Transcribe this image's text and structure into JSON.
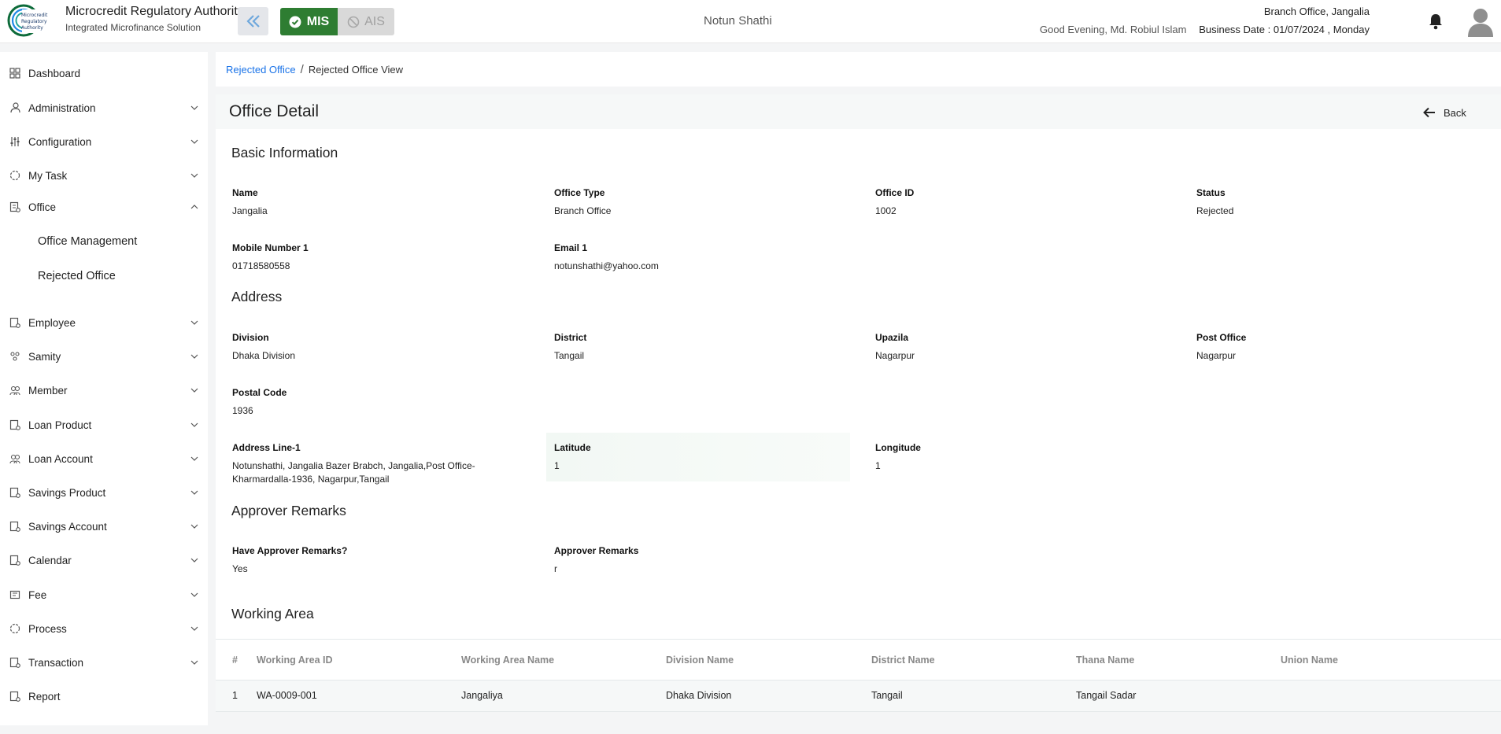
{
  "header": {
    "brand_title": "Microcredit Regulatory Authority",
    "brand_subtitle": "Integrated Microfinance Solution",
    "logo_text": "Microcredit Regulatory Authority",
    "mode_active": "MIS",
    "mode_inactive": "AIS",
    "org_name": "Notun Shathi",
    "greeting": "Good Evening, Md. Robiul Islam",
    "branch": "Branch Office, Jangalia",
    "business_date": "Business Date : 01/07/2024 , Monday",
    "accent_color": "#2e7d32"
  },
  "sidebar": {
    "items": [
      {
        "label": "Dashboard",
        "icon": "dashboard-icon",
        "chevron": false
      },
      {
        "label": "Administration",
        "icon": "admin-icon",
        "chevron": true
      },
      {
        "label": "Configuration",
        "icon": "config-icon",
        "chevron": true
      },
      {
        "label": "My Task",
        "icon": "task-icon",
        "chevron": true
      },
      {
        "label": "Office",
        "icon": "office-icon",
        "chevron": true,
        "expanded": true
      },
      {
        "label": "Employee",
        "icon": "employee-icon",
        "chevron": true
      },
      {
        "label": "Samity",
        "icon": "samity-icon",
        "chevron": true
      },
      {
        "label": "Member",
        "icon": "member-icon",
        "chevron": true
      },
      {
        "label": "Loan Product",
        "icon": "loan-product-icon",
        "chevron": true
      },
      {
        "label": "Loan Account",
        "icon": "loan-account-icon",
        "chevron": true
      },
      {
        "label": "Savings Product",
        "icon": "savings-product-icon",
        "chevron": true
      },
      {
        "label": "Savings Account",
        "icon": "savings-account-icon",
        "chevron": true
      },
      {
        "label": "Calendar",
        "icon": "calendar-icon",
        "chevron": true
      },
      {
        "label": "Fee",
        "icon": "fee-icon",
        "chevron": true
      },
      {
        "label": "Process",
        "icon": "process-icon",
        "chevron": true
      },
      {
        "label": "Transaction",
        "icon": "transaction-icon",
        "chevron": true
      },
      {
        "label": "Report",
        "icon": "report-icon",
        "chevron": false
      }
    ],
    "office_sub": [
      "Office Management",
      "Rejected Office"
    ]
  },
  "breadcrumb": {
    "parent": "Rejected Office",
    "separator": "/",
    "current": "Rejected Office View"
  },
  "page": {
    "title": "Office Detail",
    "back_label": "Back"
  },
  "basic": {
    "title": "Basic Information",
    "name_label": "Name",
    "name": "Jangalia",
    "type_label": "Office Type",
    "type": "Branch Office",
    "id_label": "Office ID",
    "id": "1002",
    "status_label": "Status",
    "status": "Rejected",
    "mobile_label": "Mobile Number 1",
    "mobile": "01718580558",
    "email_label": "Email 1",
    "email": "notunshathi@yahoo.com"
  },
  "address": {
    "title": "Address",
    "division_label": "Division",
    "division": "Dhaka Division",
    "district_label": "District",
    "district": "Tangail",
    "upazila_label": "Upazila",
    "upazila": "Nagarpur",
    "post_label": "Post Office",
    "post": "Nagarpur",
    "postal_label": "Postal Code",
    "postal": "1936",
    "line1_label": "Address Line-1",
    "line1": "Notunshathi, Jangalia Bazer Brabch, Jangalia,Post Office-Kharmardalla-1936, Nagarpur,Tangail",
    "lat_label": "Latitude",
    "lat": "1",
    "lng_label": "Longitude",
    "lng": "1"
  },
  "remarks": {
    "title": "Approver Remarks",
    "have_label": "Have Approver Remarks?",
    "have": "Yes",
    "remarks_label": "Approver Remarks",
    "remarks": "r"
  },
  "working_area": {
    "title": "Working Area",
    "columns": [
      "#",
      "Working Area ID",
      "Working Area Name",
      "Division Name",
      "District Name",
      "Thana Name",
      "Union Name"
    ],
    "rows": [
      [
        "1",
        "WA-0009-001",
        "Jangaliya",
        "Dhaka Division",
        "Tangail",
        "Tangail Sadar",
        ""
      ]
    ]
  }
}
